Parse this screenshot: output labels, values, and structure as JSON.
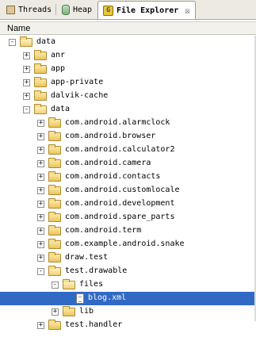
{
  "tabs": [
    {
      "label": "Threads",
      "icon": "threads-icon",
      "active": false
    },
    {
      "label": "Heap",
      "icon": "heap-icon",
      "active": false
    },
    {
      "label": "File Explorer",
      "icon": "file-explorer-icon",
      "active": true
    }
  ],
  "close_glyph": "☒",
  "header": {
    "name": "Name"
  },
  "colors": {
    "selection": "#316ac5",
    "folder": "#f0d27a"
  },
  "tree": [
    {
      "label": "data",
      "depth": 0,
      "expander": "-",
      "type": "folder-open"
    },
    {
      "label": "anr",
      "depth": 1,
      "expander": "+",
      "type": "folder"
    },
    {
      "label": "app",
      "depth": 1,
      "expander": "+",
      "type": "folder"
    },
    {
      "label": "app-private",
      "depth": 1,
      "expander": "+",
      "type": "folder"
    },
    {
      "label": "dalvik-cache",
      "depth": 1,
      "expander": "+",
      "type": "folder"
    },
    {
      "label": "data",
      "depth": 1,
      "expander": "-",
      "type": "folder-open"
    },
    {
      "label": "com.android.alarmclock",
      "depth": 2,
      "expander": "+",
      "type": "folder"
    },
    {
      "label": "com.android.browser",
      "depth": 2,
      "expander": "+",
      "type": "folder"
    },
    {
      "label": "com.android.calculator2",
      "depth": 2,
      "expander": "+",
      "type": "folder"
    },
    {
      "label": "com.android.camera",
      "depth": 2,
      "expander": "+",
      "type": "folder"
    },
    {
      "label": "com.android.contacts",
      "depth": 2,
      "expander": "+",
      "type": "folder"
    },
    {
      "label": "com.android.customlocale",
      "depth": 2,
      "expander": "+",
      "type": "folder"
    },
    {
      "label": "com.android.development",
      "depth": 2,
      "expander": "+",
      "type": "folder"
    },
    {
      "label": "com.android.spare_parts",
      "depth": 2,
      "expander": "+",
      "type": "folder"
    },
    {
      "label": "com.android.term",
      "depth": 2,
      "expander": "+",
      "type": "folder"
    },
    {
      "label": "com.example.android.snake",
      "depth": 2,
      "expander": "+",
      "type": "folder"
    },
    {
      "label": "draw.test",
      "depth": 2,
      "expander": "+",
      "type": "folder"
    },
    {
      "label": "test.drawable",
      "depth": 2,
      "expander": "-",
      "type": "folder-open"
    },
    {
      "label": "files",
      "depth": 3,
      "expander": "-",
      "type": "folder-open"
    },
    {
      "label": "blog.xml",
      "depth": 4,
      "expander": "",
      "type": "file",
      "selected": true
    },
    {
      "label": "lib",
      "depth": 3,
      "expander": "+",
      "type": "folder"
    },
    {
      "label": "test.handler",
      "depth": 2,
      "expander": "+",
      "type": "folder"
    }
  ]
}
